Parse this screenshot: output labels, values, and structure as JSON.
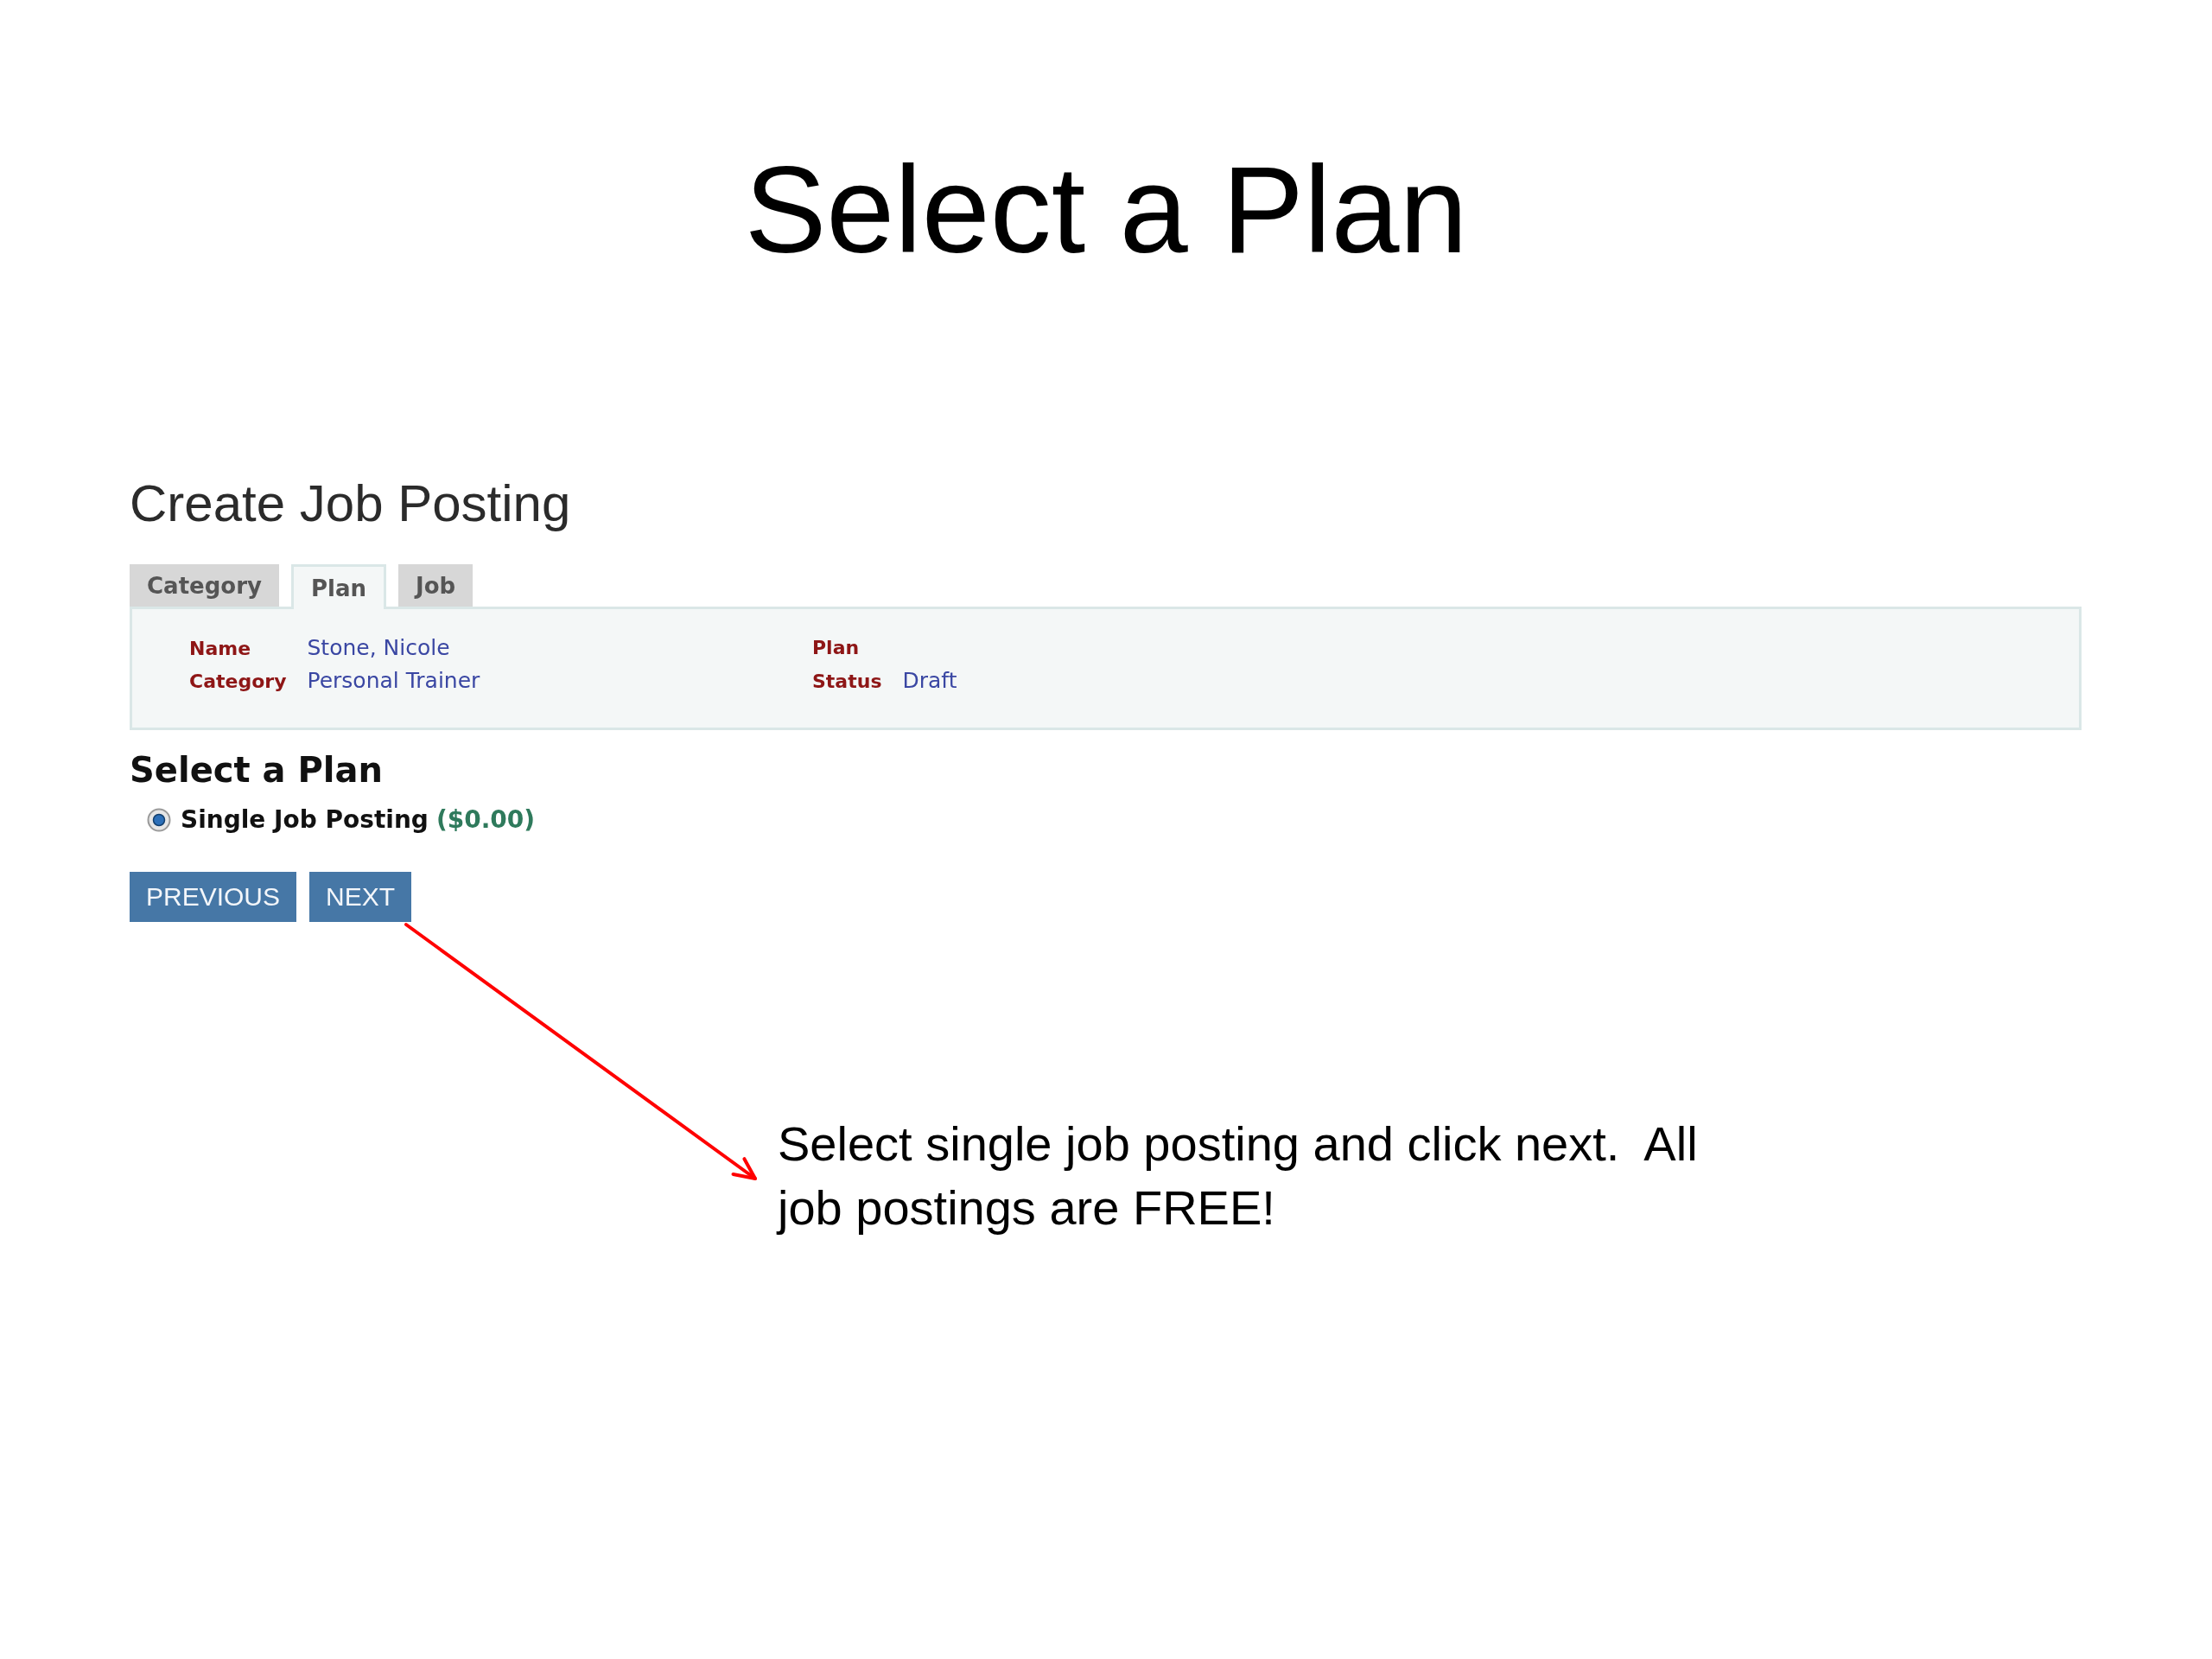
{
  "slide": {
    "title": "Select a Plan"
  },
  "page": {
    "heading": "Create Job Posting"
  },
  "tabs": [
    {
      "label": "Category",
      "selected": false
    },
    {
      "label": "Plan",
      "selected": true
    },
    {
      "label": "Job",
      "selected": false
    }
  ],
  "summary": {
    "columns": [
      [
        {
          "label": "Name",
          "value": "Stone, Nicole"
        },
        {
          "label": "Category",
          "value": "Personal Trainer"
        }
      ],
      [
        {
          "label": "Plan"
        },
        {
          "label": "Status",
          "value": "Draft"
        }
      ]
    ]
  },
  "plan_section": {
    "heading": "Select a Plan",
    "options": [
      {
        "label": "Single Job Posting",
        "price": "($0.00)",
        "selected": true
      }
    ]
  },
  "buttons": [
    {
      "label": "PREVIOUS"
    },
    {
      "label": "NEXT"
    }
  ],
  "annotation": {
    "text": "Select single job posting and click next.  All job postings are FREE!"
  }
}
